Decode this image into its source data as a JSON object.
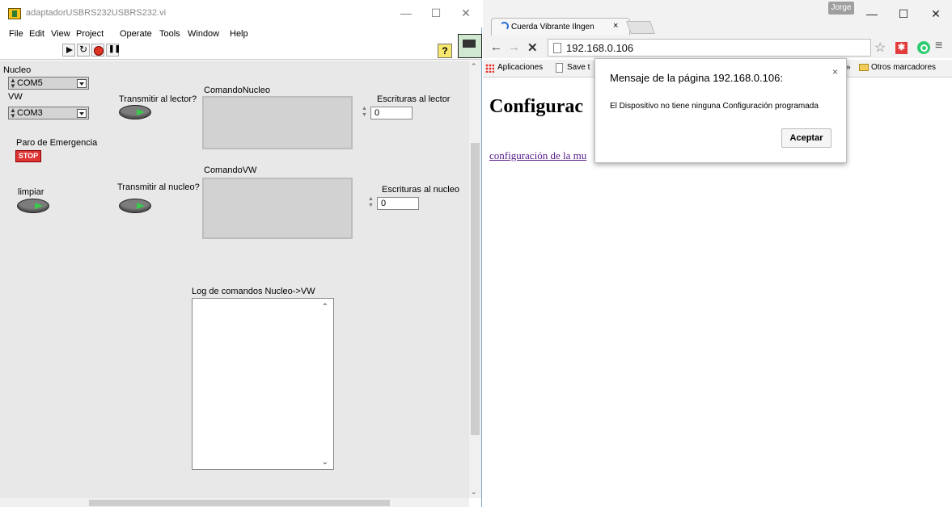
{
  "labview": {
    "title": "adaptadorUSBRS232USBRS232.vi",
    "window_controls": [
      "—",
      "☐",
      "✕"
    ],
    "menu": [
      "File",
      "Edit",
      "View",
      "Project",
      "Operate",
      "Tools",
      "Window",
      "Help"
    ],
    "help_label": "?",
    "vi_connector": "2",
    "panel": {
      "nucleo_label": "Nucleo",
      "nucleo_value": "COM5",
      "vw_label": "VW",
      "vw_value": "COM3",
      "transmitir_lector_label": "Transmitir al lector?",
      "transmitir_nucleo_label": "Transmitir al nucleo?",
      "comando_nucleo_label": "ComandoNucleo",
      "comando_vw_label": "ComandoVW",
      "escrituras_lector_label": "Escrituras al lector",
      "escrituras_lector_value": "0",
      "escrituras_nucleo_label": "Escrituras al nucleo",
      "escrituras_nucleo_value": "0",
      "paro_label": "Paro de Emergencia",
      "stop_label": "STOP",
      "limpiar_label": "limpiar",
      "log_label": "Log de comandos Nucleo->VW"
    }
  },
  "chrome": {
    "tab_title": "Cuerda Vibrante Ilngen",
    "tab_close": "×",
    "user": "Jorge",
    "window_controls": [
      "—",
      "☐",
      "✕"
    ],
    "url": "192.168.0.106",
    "bookmarks": {
      "apps": "Aplicaciones",
      "save": "Save t",
      "more": "»",
      "others": "Otros marcadores"
    },
    "page": {
      "heading": "Configurac",
      "link": "configuración de la mu"
    },
    "dialog": {
      "title": "Mensaje de la página 192.168.0.106:",
      "close": "×",
      "message": "El Dispositivo no tiene ninguna Configuración programada",
      "ok": "Aceptar"
    }
  },
  "colors": {
    "accent_green": "#39c94b",
    "stop_red": "#d33333",
    "link_purple": "#551a8b"
  }
}
